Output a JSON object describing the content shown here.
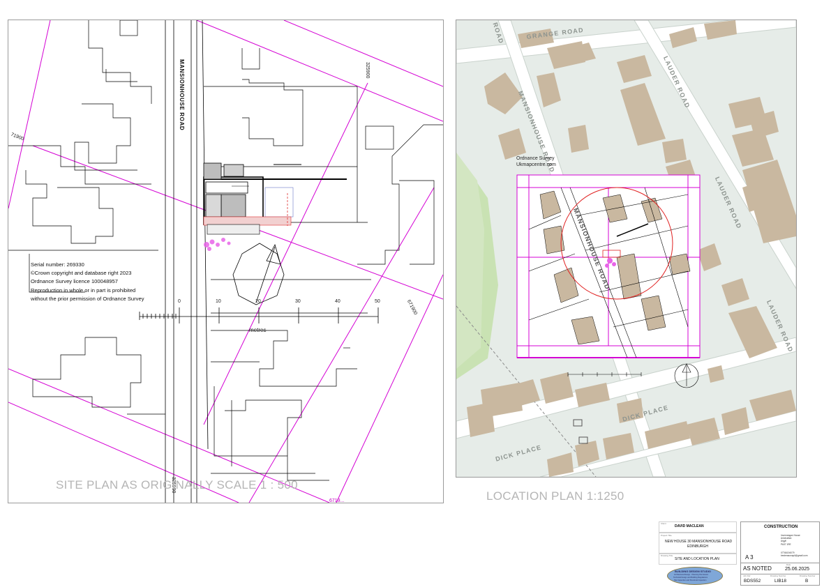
{
  "site_plan": {
    "road_label": "MANSIONHOUSE ROAD",
    "grid_labels": {
      "left": "71900",
      "top": "325900",
      "right": "671900",
      "bottom": "325900",
      "bottom_right": "6719..."
    },
    "os_note": [
      "Serial number: 269330",
      "©Crown copyright and database right 2023",
      "Ordnance Survey licence 100048957",
      "Reproduction in whole or in part is prohibited",
      "without the prior permission of Ordnance Survey"
    ],
    "scale_bar": {
      "ticks": [
        "0",
        "10",
        "20",
        "30",
        "40",
        "50"
      ],
      "unit": "metres"
    },
    "caption": "SITE PLAN AS ORIGINALLY SCALE 1 : 500"
  },
  "location_plan": {
    "roads": {
      "grange_road": "GRANGE ROAD",
      "lauder_road_1": "LAUDER ROAD",
      "lauder_road_2": "LAUDER ROAD",
      "lauder_road_3": "LAUDER ROAD",
      "mansionhouse_road_1": "MANSIONHOUSE ROAD",
      "mansionhouse_road_2": "MANSIONHOUSE ROAD",
      "dick_place_1": "DICK PLACE",
      "dick_place_2": "DICK PLACE",
      "corner_road": "ROAD"
    },
    "credit_line_1": "Ordnance Survey",
    "credit_line_2": "Ukmapcentre.com",
    "caption": "LOCATION PLAN 1:1250"
  },
  "title_block": {
    "client_caption": "Client",
    "client": "DAVID MACLEAN",
    "project_caption": "Project Title",
    "project_line_1": "NEW HOUSE 30 MANSIONHOUSE ROAD",
    "project_line_2": "EDINBURGH",
    "drawing_caption": "Drawing Title",
    "drawing_title": "SITE AND LOCATION PLAN",
    "logo_line_1": "BUILDING DESIGN STUDIO",
    "logo_line_2": "Architectural Design · Planning Permission",
    "logo_line_3": "Technical Design and Building Regulations",
    "logo_line_4": "Site Inspection and Structural Inspection",
    "status": "CONSTRUCTION",
    "address_1": "Inverneagan House",
    "address_2": "Ardchattan",
    "address_3": "Argyll",
    "address_4": "PA37 1RE",
    "phone": "07766194079",
    "email": "bestreasonquil@gmail.com",
    "paper_size": "A 3",
    "scale": "AS NOTED",
    "date_caption": "Date",
    "date": "25.06.2025",
    "job_caption": "Job Ref",
    "job_number": "BDS552",
    "drawing_no_caption": "Drawing Number",
    "drawing_number": "LIB18",
    "revision_caption": "Drawing Number",
    "revision": "B"
  },
  "colors": {
    "grid_magenta": "#d400d4",
    "circle_red": "#e02020",
    "building_tan": "#c9b8a0",
    "green_space": "#c9e2b3",
    "map_bg": "#e6ece8"
  }
}
